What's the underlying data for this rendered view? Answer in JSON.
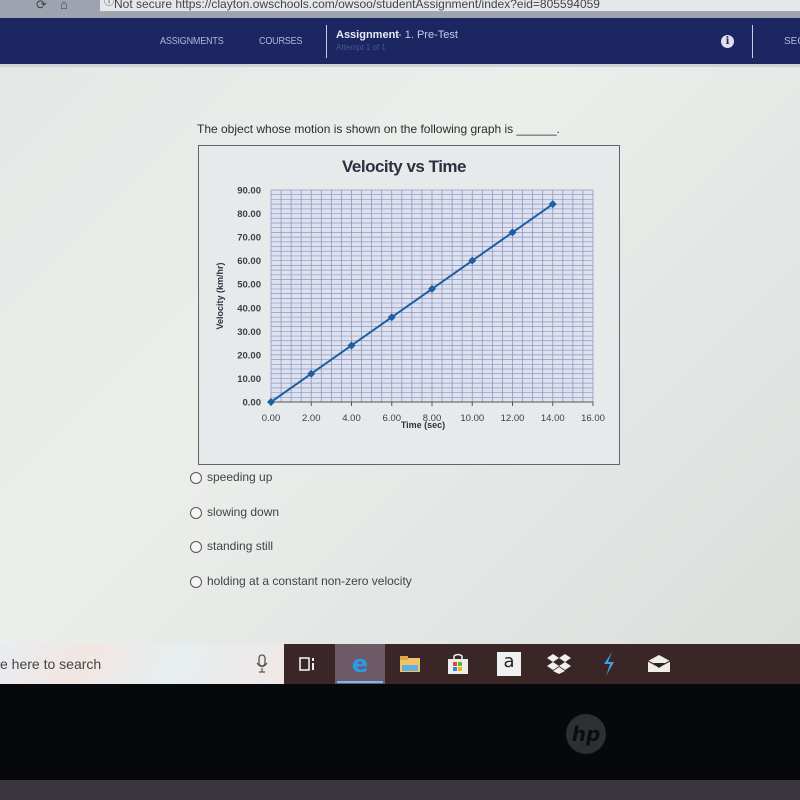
{
  "browser": {
    "security_label": "Not secure",
    "url": "https://clayton.owschools.com/owsoo/studentAssignment/index?eid=805594059"
  },
  "header": {
    "nav": [
      "ASSIGNMENTS",
      "COURSES"
    ],
    "assignment_label": "Assignment",
    "assignment_name": "- 1. Pre-Test",
    "attempt": "Attempt 1 of 1",
    "right_label": "SEC"
  },
  "question": {
    "text": "The object whose motion is shown on the following graph is ______.",
    "options": [
      "speeding up",
      "slowing down",
      "standing still",
      "holding at a constant non-zero velocity"
    ]
  },
  "chart_data": {
    "type": "line",
    "title": "Velocity vs Time",
    "xlabel": "Time (sec)",
    "ylabel": "Velocity (km/hr)",
    "x": [
      0,
      2,
      4,
      6,
      8,
      10,
      12,
      14
    ],
    "series": [
      {
        "name": "Velocity",
        "values": [
          0,
          12,
          24,
          36,
          48,
          60,
          72,
          84
        ]
      }
    ],
    "xlim": [
      0,
      16
    ],
    "ylim": [
      0,
      90
    ],
    "xticks": [
      "0.00",
      "2.00",
      "4.00",
      "6.00",
      "8.00",
      "10.00",
      "12.00",
      "14.00",
      "16.00"
    ],
    "yticks": [
      "0.00",
      "10.00",
      "20.00",
      "30.00",
      "40.00",
      "50.00",
      "60.00",
      "70.00",
      "80.00",
      "90.00"
    ],
    "grid": true,
    "legend": "none",
    "colors": {
      "line": "#1f5fa0",
      "grid": "#8f97c4"
    }
  },
  "taskbar": {
    "search_placeholder": "e here to search",
    "icons": [
      "microphone",
      "task-view",
      "edge",
      "file-explorer",
      "store",
      "amazon",
      "dropbox",
      "app-bolt",
      "mail"
    ]
  },
  "bezel": {
    "brand": "hp"
  }
}
